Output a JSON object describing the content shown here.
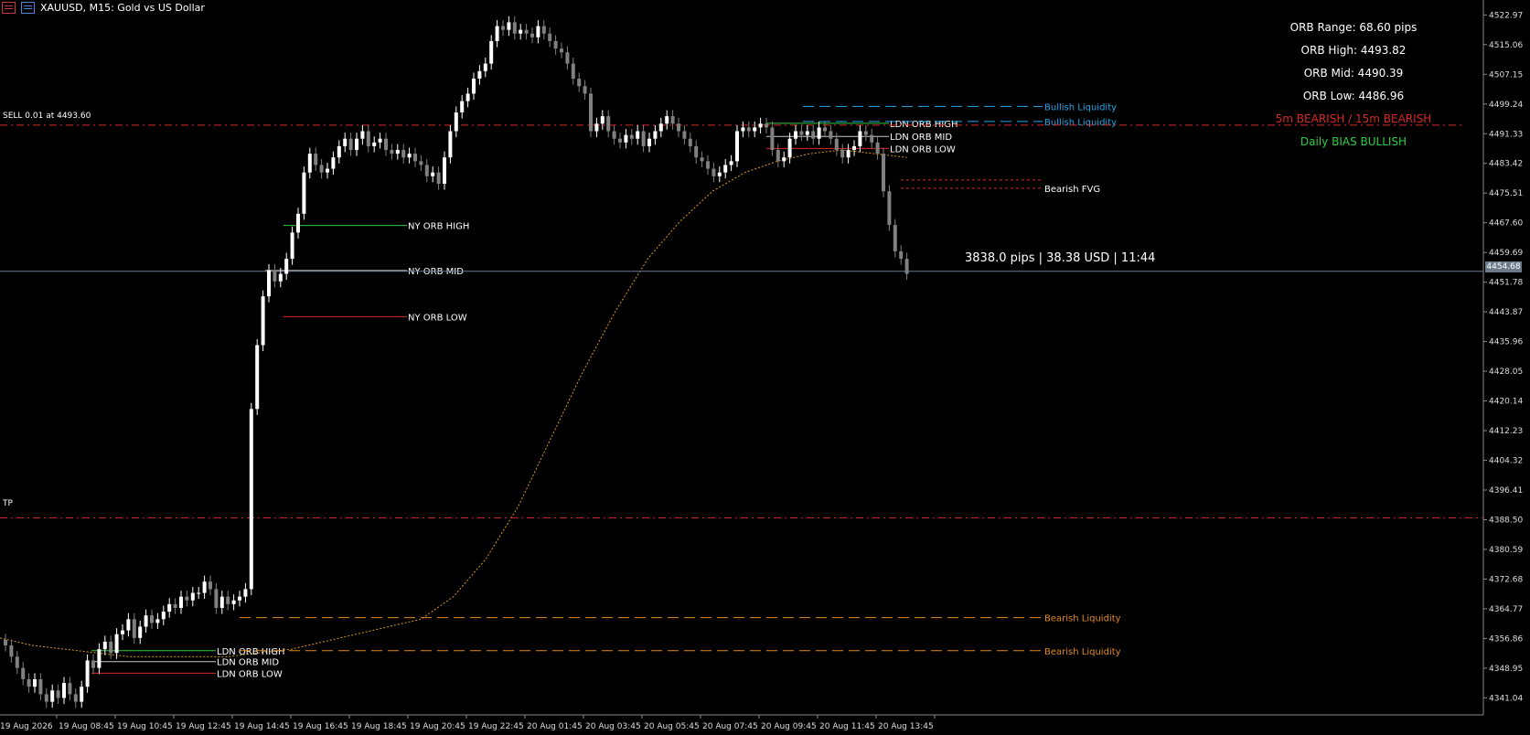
{
  "window": {
    "symbol_title": "XAUUSD, M15:  Gold vs US Dollar"
  },
  "colors": {
    "background": "#000000",
    "bull_candle": "#ffffff",
    "bear_candle": "#808080",
    "order_line": "#d62828",
    "ma_line": "#d89a1f",
    "bid_line": "#6b7b8c",
    "liquidity_bull": "#1fa7e8",
    "liquidity_bear": "#e08a1f",
    "orb_high": "#2ecc40",
    "orb_mid": "#c8c8c8",
    "orb_low": "#d62828",
    "fvg": "#d62828",
    "bias_bullish": "#2ecc40",
    "bias_bearish": "#d62828"
  },
  "info_panel": {
    "orb_range": "ORB Range: 68.60 pips",
    "orb_high": "ORB High: 4493.82",
    "orb_mid": "ORB Mid: 4490.39",
    "orb_low": "ORB Low: 4486.96",
    "tf_bias": "5m BEARISH / 15m BEARISH",
    "daily_bias": "Daily BIAS BULLISH"
  },
  "order": {
    "label": "SELL 0.01 at 4493.60",
    "price": 4493.6,
    "tp_label": "TP",
    "tp_price": 4389.0
  },
  "current": {
    "bid_price": 4454.68,
    "bid_label": "4454.68",
    "pips_label": "3838.0 pips | 38.38 USD | 11:44"
  },
  "chart_data": {
    "type": "candlestick",
    "symbol": "XAUUSD",
    "timeframe": "M15",
    "ylim": [
      4336.5,
      4525.0
    ],
    "price_ticks": [
      "4522.97",
      "4515.06",
      "4507.15",
      "4499.24",
      "4491.33",
      "4483.42",
      "4475.51",
      "4467.60",
      "4459.69",
      "4451.78",
      "4443.87",
      "4435.96",
      "4428.05",
      "4420.14",
      "4412.23",
      "4404.32",
      "4396.41",
      "4388.50",
      "4380.59",
      "4372.68",
      "4364.77",
      "4356.86",
      "4348.95",
      "4341.04"
    ],
    "time_ticks": [
      "19 Aug 2026",
      "19 Aug 08:45",
      "19 Aug 10:45",
      "19 Aug 12:45",
      "19 Aug 14:45",
      "19 Aug 16:45",
      "19 Aug 18:45",
      "19 Aug 20:45",
      "19 Aug 22:45",
      "20 Aug 01:45",
      "20 Aug 03:45",
      "20 Aug 05:45",
      "20 Aug 07:45",
      "20 Aug 09:45",
      "20 Aug 11:45",
      "20 Aug 13:45"
    ],
    "candles_close": [
      4355,
      4352,
      4349,
      4346,
      4344,
      4346,
      4342,
      4340,
      4343,
      4341,
      4345,
      4342,
      4340,
      4344,
      4351,
      4349,
      4354,
      4356,
      4353,
      4358,
      4359,
      4362,
      4357,
      4360,
      4363,
      4361,
      4362,
      4364,
      4366,
      4365,
      4368,
      4367,
      4369,
      4369,
      4372,
      4370,
      4365,
      4368,
      4366,
      4367,
      4368,
      4370,
      4418,
      4435,
      4448,
      4455,
      4452,
      4454,
      4458,
      4465,
      4470,
      4481,
      4486,
      4483,
      4481,
      4482,
      4485,
      4488,
      4490,
      4487,
      4490,
      4492,
      4488,
      4489,
      4490,
      4487,
      4486,
      4487,
      4485,
      4486,
      4484,
      4483,
      4480,
      4481,
      4478,
      4485,
      4492,
      4497,
      4500,
      4502,
      4506,
      4508,
      4510,
      4516,
      4520,
      4519,
      4521,
      4518,
      4519,
      4518,
      4517,
      4520,
      4518,
      4516,
      4514,
      4513,
      4510,
      4506,
      4504,
      4502,
      4492,
      4494,
      4496,
      4492,
      4490,
      4489,
      4491,
      4490,
      4492,
      4488,
      4490,
      4492,
      4494,
      4496,
      4494,
      4492,
      4490,
      4488,
      4485,
      4484,
      4482,
      4480,
      4481,
      4483,
      4484,
      4492,
      4493,
      4492,
      4493,
      4494,
      4493,
      4487,
      4484,
      4485,
      4490,
      4492,
      4491,
      4492,
      4490,
      4493,
      4492,
      4490,
      4487,
      4485,
      4487,
      4488,
      4492,
      4491,
      4489,
      4486,
      4476,
      4467,
      4460,
      4458,
      4454
    ],
    "moving_average": [
      4357,
      4355,
      4354,
      4353,
      4352,
      4352,
      4352,
      4352,
      4353,
      4354,
      4356,
      4358,
      4360,
      4362,
      4368,
      4378,
      4392,
      4410,
      4428,
      4444,
      4458,
      4468,
      4476,
      4481,
      4484,
      4486,
      4487,
      4486,
      4485
    ],
    "levels": [
      {
        "label": "NY ORB HIGH",
        "price": 4466.9
      },
      {
        "label": "NY ORB MID",
        "price": 4454.9
      },
      {
        "label": "NY ORB LOW",
        "price": 4442.6
      },
      {
        "label": "LDN ORB HIGH",
        "price": 4353.6
      },
      {
        "label": "LDN ORB MID",
        "price": 4350.7
      },
      {
        "label": "LDN ORB LOW",
        "price": 4347.6
      },
      {
        "label": "LDN ORB HIGH",
        "price": 4494.1
      },
      {
        "label": "LDN ORB MID",
        "price": 4490.6
      },
      {
        "label": "LDN ORB LOW",
        "price": 4487.4
      },
      {
        "label": "Bullish Liquidity",
        "price": 4498.6
      },
      {
        "label": "Bullish Liquidity",
        "price": 4494.6
      },
      {
        "label": "Bearish Liquidity",
        "price": 4362.4
      },
      {
        "label": "Bearish Liquidity",
        "price": 4353.6
      },
      {
        "label": "Bearish FVG",
        "price": 4476.8
      }
    ]
  }
}
